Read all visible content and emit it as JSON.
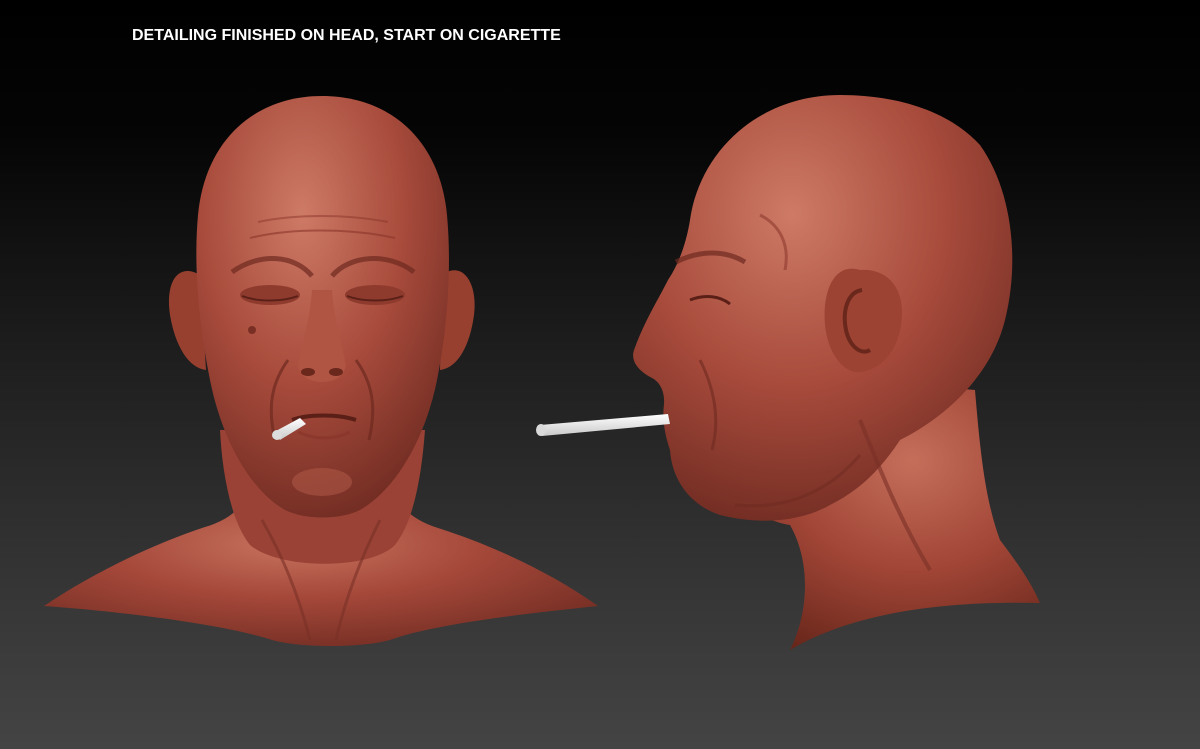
{
  "caption": "DETAILING FINISHED ON HEAD, START ON CIGARETTE",
  "colors": {
    "background_top": "#000000",
    "background_bottom": "#444444",
    "clay": "#a5483a",
    "clay_shadow": "#6e2a20",
    "clay_highlight": "#c8735f",
    "cigarette": "#f2f2f2",
    "caption_text": "#ffffff"
  },
  "figures": [
    {
      "view": "front"
    },
    {
      "view": "side"
    }
  ]
}
